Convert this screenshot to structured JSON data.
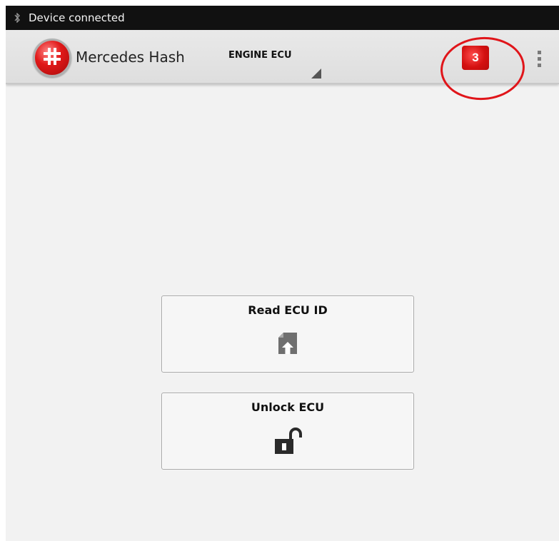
{
  "status_bar": {
    "icon": "bluetooth-icon",
    "text": "Device connected"
  },
  "action_bar": {
    "app_title": "Mercedes Hash",
    "logo_icon": "hash-icon",
    "spinner": {
      "selected": "ENGINE ECU"
    },
    "badge_count": "3",
    "overflow_icon": "overflow-menu-icon"
  },
  "buttons": {
    "read": {
      "label": "Read ECU ID",
      "icon": "file-download-icon"
    },
    "unlock": {
      "label": "Unlock ECU",
      "icon": "unlock-icon"
    }
  },
  "colors": {
    "accent_red": "#e11919",
    "status_bar_bg": "#111111",
    "action_bar_bg": "#e4e4e4",
    "background": "#f2f2f2",
    "annotation": "#e0151a"
  }
}
